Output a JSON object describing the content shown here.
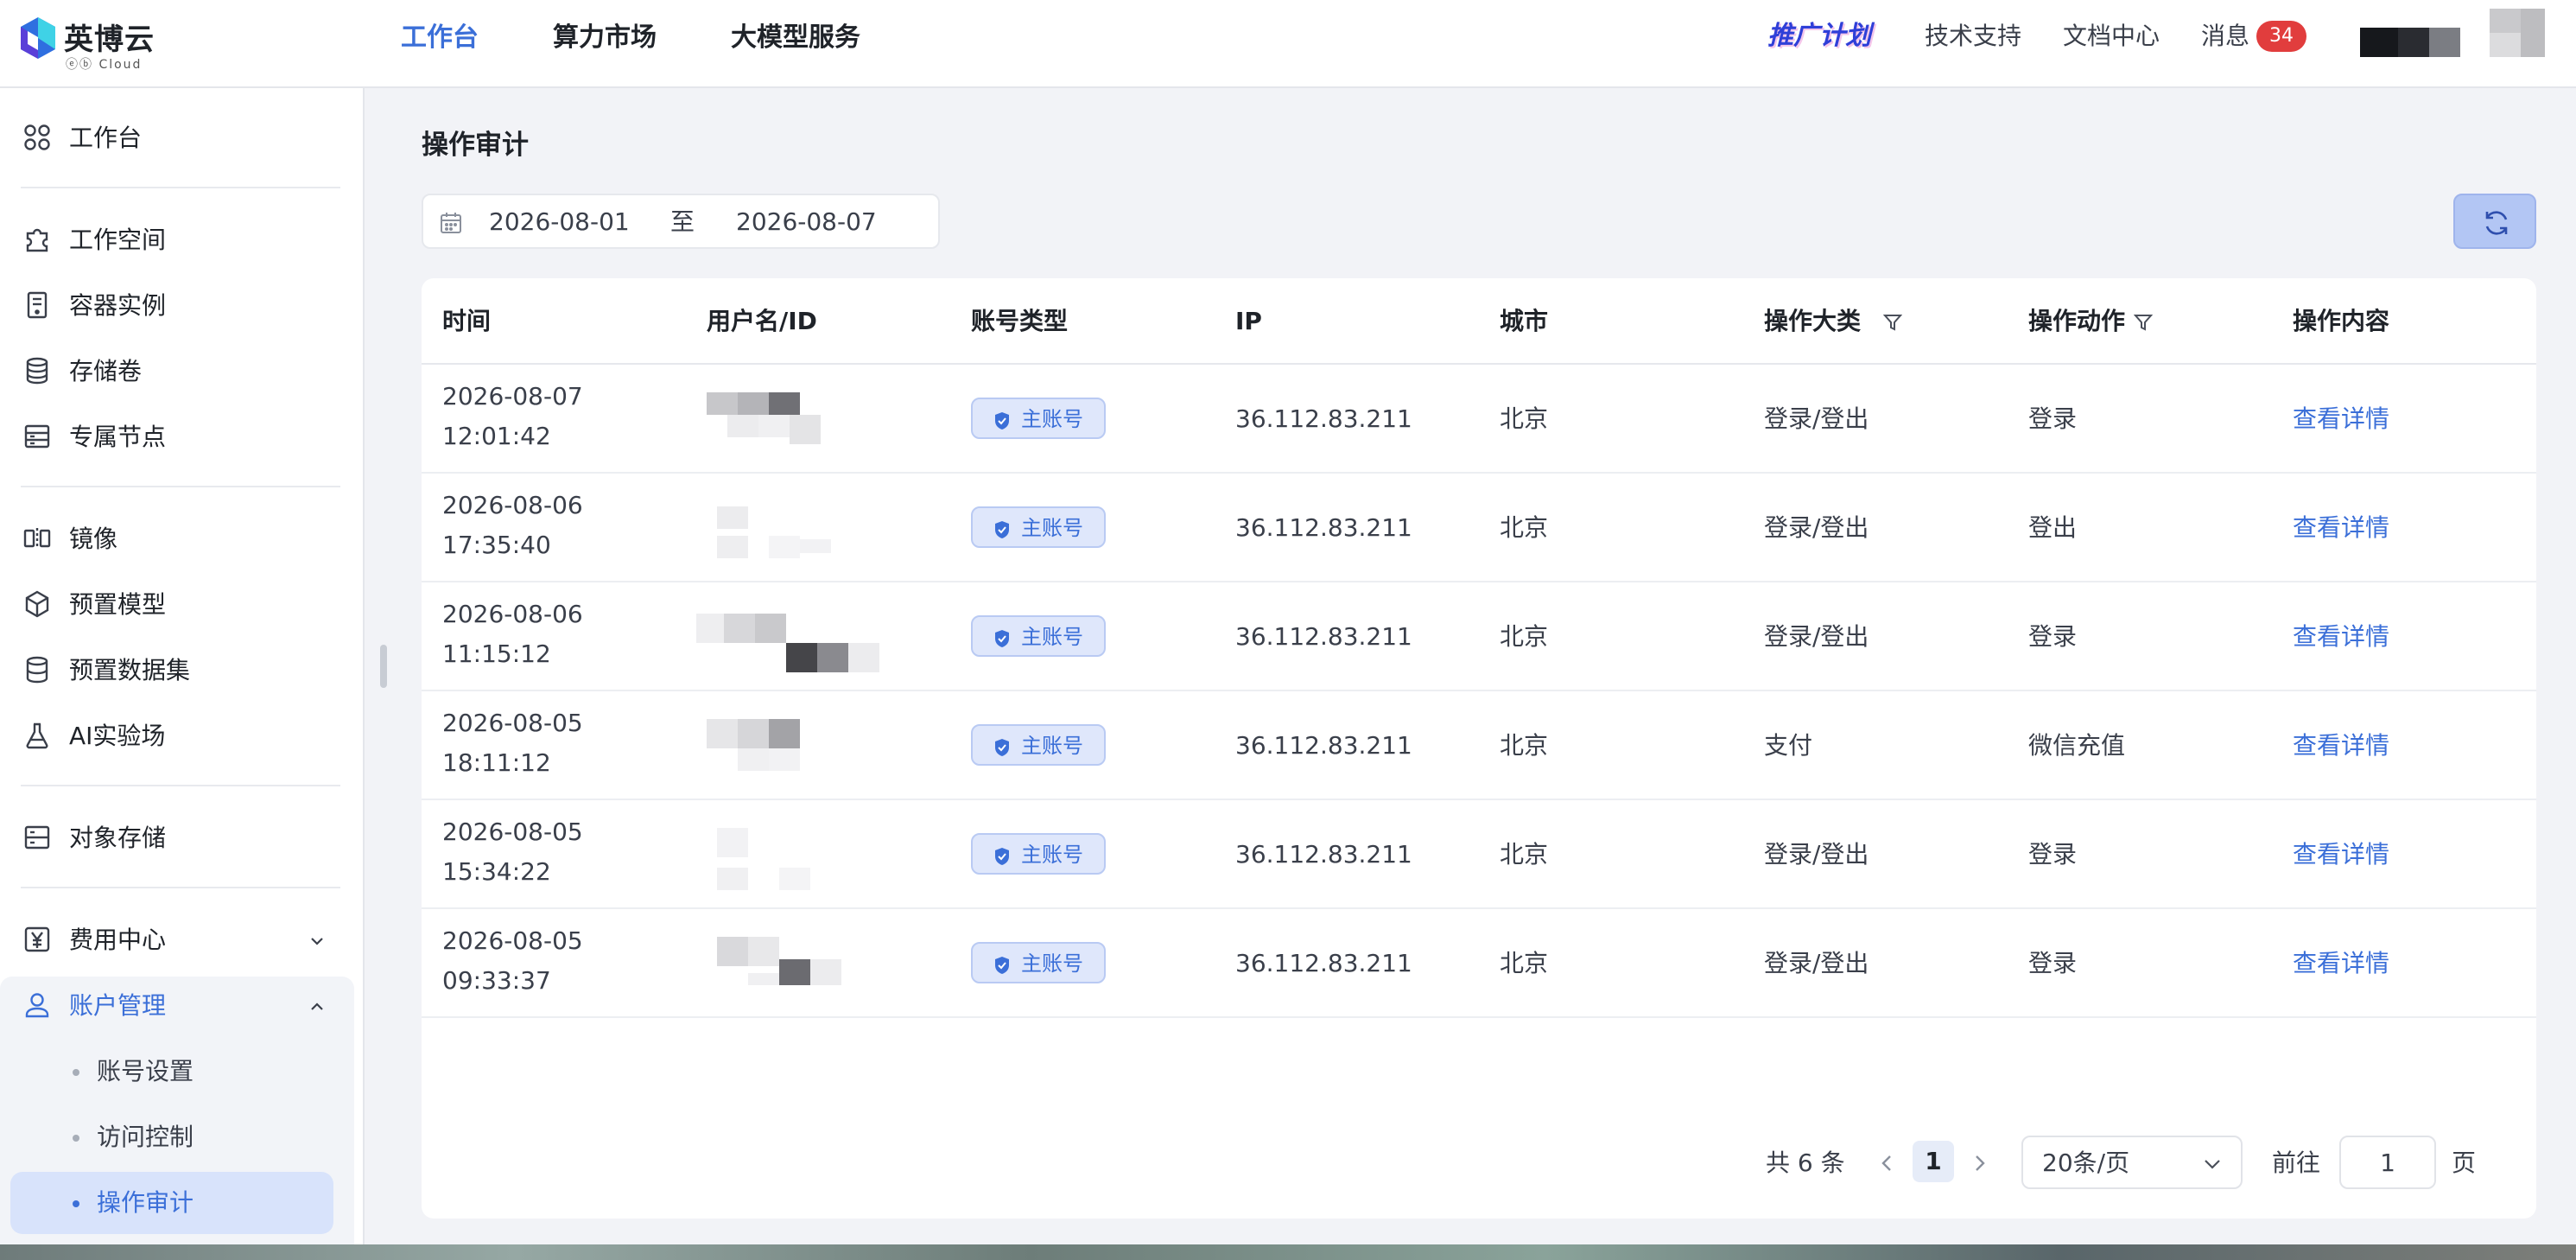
{
  "brand": {
    "name": "英博云",
    "sub": "ⓔⓑ Cloud"
  },
  "top_nav": [
    {
      "label": "工作台",
      "active": true
    },
    {
      "label": "算力市场",
      "active": false
    },
    {
      "label": "大模型服务",
      "active": false
    }
  ],
  "header": {
    "promo": "推广计划",
    "support": "技术支持",
    "docs": "文档中心",
    "messages": "消息",
    "message_count": "34"
  },
  "sidebar": {
    "workbench": "工作台",
    "workspace": "工作空间",
    "container": "容器实例",
    "volume": "存储卷",
    "dedicated_node": "专属节点",
    "image": "镜像",
    "preset_model": "预置模型",
    "preset_dataset": "预置数据集",
    "ai_lab": "AI实验场",
    "object_storage": "对象存储",
    "billing": "费用中心",
    "account": "账户管理",
    "sub": {
      "account_settings": "账号设置",
      "access_control": "访问控制",
      "audit": "操作审计"
    }
  },
  "page": {
    "title": "操作审计",
    "date_start": "2026-08-01",
    "date_sep": "至",
    "date_end": "2026-08-07"
  },
  "table": {
    "columns": [
      "时间",
      "用户名/ID",
      "账号类型",
      "IP",
      "城市",
      "操作大类",
      "操作动作",
      "操作内容"
    ],
    "rows": [
      {
        "date": "2026-08-07",
        "clock": "12:01:42",
        "acct": "主账号",
        "ip": "36.112.83.211",
        "city": "北京",
        "category": "登录/登出",
        "action": "登录",
        "detail": "查看详情"
      },
      {
        "date": "2026-08-06",
        "clock": "17:35:40",
        "acct": "主账号",
        "ip": "36.112.83.211",
        "city": "北京",
        "category": "登录/登出",
        "action": "登出",
        "detail": "查看详情"
      },
      {
        "date": "2026-08-06",
        "clock": "11:15:12",
        "acct": "主账号",
        "ip": "36.112.83.211",
        "city": "北京",
        "category": "登录/登出",
        "action": "登录",
        "detail": "查看详情"
      },
      {
        "date": "2026-08-05",
        "clock": "18:11:12",
        "acct": "主账号",
        "ip": "36.112.83.211",
        "city": "北京",
        "category": "支付",
        "action": "微信充值",
        "detail": "查看详情"
      },
      {
        "date": "2026-08-05",
        "clock": "15:34:22",
        "acct": "主账号",
        "ip": "36.112.83.211",
        "city": "北京",
        "category": "登录/登出",
        "action": "登录",
        "detail": "查看详情"
      },
      {
        "date": "2026-08-05",
        "clock": "09:33:37",
        "acct": "主账号",
        "ip": "36.112.83.211",
        "city": "北京",
        "category": "登录/登出",
        "action": "登录",
        "detail": "查看详情"
      }
    ]
  },
  "pagination": {
    "total": "共 6 条",
    "current": "1",
    "page_size": "20条/页",
    "goto": "前往",
    "goto_value": "1",
    "unit": "页"
  },
  "colors": {
    "accent": "#3b6fd8",
    "badge_red": "#e13d3d",
    "refresh_bg": "#b3c6f4"
  }
}
